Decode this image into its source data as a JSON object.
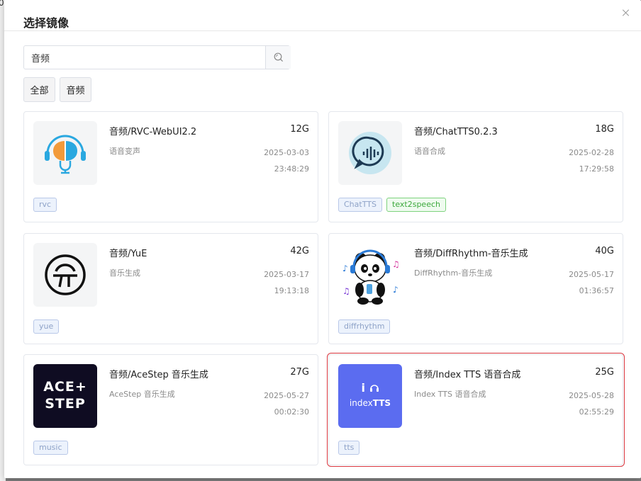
{
  "backdrop": {
    "glyph": "0"
  },
  "dialog": {
    "title": "选择镜像"
  },
  "search": {
    "value": "音频",
    "placeholder": "",
    "icon": "search-icon"
  },
  "filters": [
    {
      "label": "全部"
    },
    {
      "label": "音频"
    }
  ],
  "cards": [
    {
      "name": "音频/RVC-WebUI2.2",
      "size": "12G",
      "desc": "语音变声",
      "date": "2025-03-03",
      "time": "23:48:29",
      "tags": [
        {
          "label": "rvc",
          "color": "blue"
        }
      ],
      "icon": "rvc-brain-headset-icon"
    },
    {
      "name": "音频/ChatTTS0.2.3",
      "size": "18G",
      "desc": "语音合成",
      "date": "2025-02-28",
      "time": "17:29:58",
      "tags": [
        {
          "label": "ChatTTS",
          "color": "blue"
        },
        {
          "label": "text2speech",
          "color": "green"
        }
      ],
      "icon": "chat-voice-bubble-icon"
    },
    {
      "name": "音频/YuE",
      "size": "42G",
      "desc": "音乐生成",
      "date": "2025-03-17",
      "time": "19:13:18",
      "tags": [
        {
          "label": "yue",
          "color": "blue"
        }
      ],
      "icon": "yue-logo-icon"
    },
    {
      "name": "音频/DiffRhythm-音乐生成",
      "size": "40G",
      "desc": "DiffRhythm-音乐生成",
      "date": "2025-05-17",
      "time": "01:36:57",
      "tags": [
        {
          "label": "diffrhythm",
          "color": "blue"
        }
      ],
      "icon": "panda-headphones-icon"
    },
    {
      "name": "音频/AceStep 音乐生成",
      "size": "27G",
      "desc": "AceStep 音乐生成",
      "date": "2025-05-27",
      "time": "00:02:30",
      "tags": [
        {
          "label": "music",
          "color": "blue"
        }
      ],
      "icon": "acestep-logo",
      "logo_text_1": "ACE+",
      "logo_text_2": "STEP"
    },
    {
      "name": "音频/Index TTS 语音合成",
      "size": "25G",
      "desc": "Index TTS 语音合成",
      "date": "2025-05-28",
      "time": "02:55:29",
      "tags": [
        {
          "label": "tts",
          "color": "blue"
        }
      ],
      "icon": "indextts-logo",
      "logo_text_1": "i",
      "logo_text_2": "index",
      "logo_text_3": "TTS"
    }
  ],
  "colors": {
    "selected_border": "#d9363e",
    "tag_blue": "#8fa3c8",
    "tag_green": "#3ca93c",
    "ace_bg": "#0f0c22",
    "index_bg": "#5b6cf0"
  }
}
